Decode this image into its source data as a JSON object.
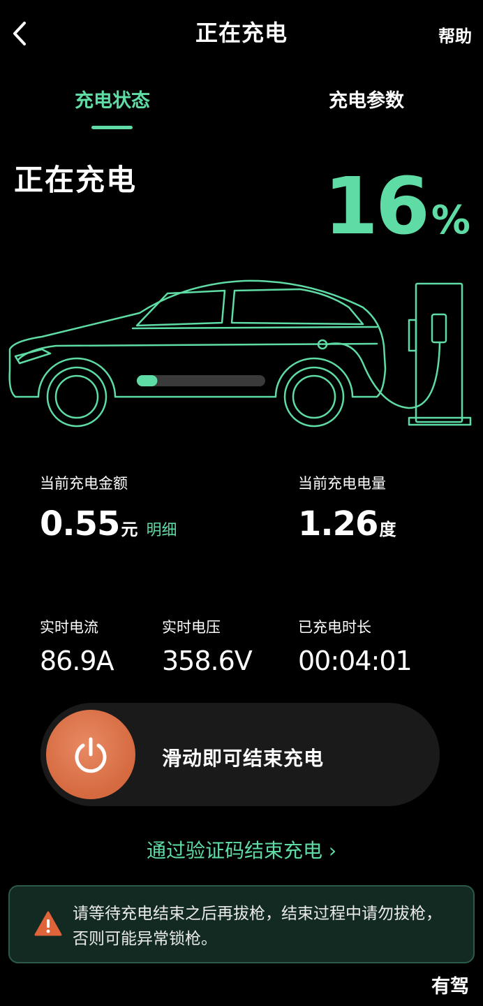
{
  "header": {
    "title": "正在充电",
    "help_label": "帮助"
  },
  "tabs": [
    {
      "label": "充电状态",
      "active": true
    },
    {
      "label": "充电参数",
      "active": false
    }
  ],
  "status": {
    "state_text": "正在充电",
    "battery_percent": "16",
    "percent_unit": "%",
    "battery_level_fraction": 0.16
  },
  "stats": {
    "amount": {
      "label": "当前充电金额",
      "value": "0.55",
      "unit": "元",
      "detail_link": "明细"
    },
    "energy": {
      "label": "当前充电电量",
      "value": "1.26",
      "unit": "度"
    },
    "current": {
      "label": "实时电流",
      "value": "86.9A"
    },
    "voltage": {
      "label": "实时电压",
      "value": "358.6V"
    },
    "duration": {
      "label": "已充电时长",
      "value": "00:04:01"
    }
  },
  "slider": {
    "label": "滑动即可结束充电"
  },
  "verify_link": {
    "label": "通过验证码结束充电 ›"
  },
  "warning": {
    "text": "请等待充电结束之后再拔枪，结束过程中请勿拔枪，否则可能异常锁枪。"
  },
  "watermark": {
    "text": "有驾"
  },
  "colors": {
    "accent": "#5fdca5",
    "background": "#000000",
    "knob": "#d86d44",
    "warning_bg": "#122a21"
  },
  "icons": {
    "back": "chevron-left-icon",
    "power": "power-icon",
    "warning": "warning-triangle-icon"
  }
}
